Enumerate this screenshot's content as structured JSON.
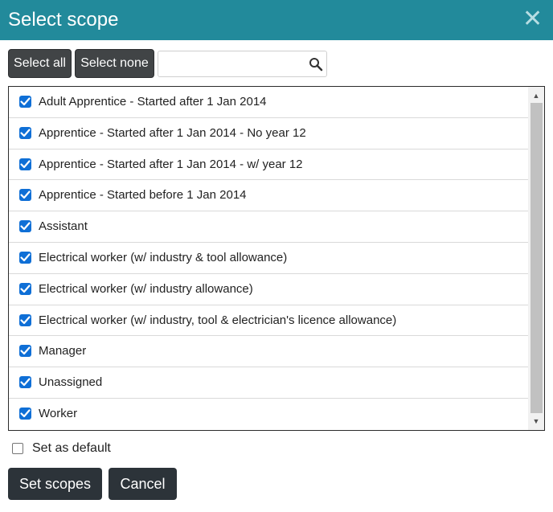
{
  "dialog": {
    "title": "Select scope",
    "close_icon": "close-icon"
  },
  "toolbar": {
    "select_all_label": "Select all",
    "select_none_label": "Select none",
    "search_value": "",
    "search_icon": "search-icon"
  },
  "scopes": [
    {
      "label": "Adult Apprentice - Started after 1 Jan 2014",
      "checked": true
    },
    {
      "label": "Apprentice - Started after 1 Jan 2014 - No year 12",
      "checked": true
    },
    {
      "label": "Apprentice - Started after 1 Jan 2014 - w/ year 12",
      "checked": true
    },
    {
      "label": "Apprentice - Started before 1 Jan 2014",
      "checked": true
    },
    {
      "label": "Assistant",
      "checked": true
    },
    {
      "label": "Electrical worker (w/ industry & tool allowance)",
      "checked": true
    },
    {
      "label": "Electrical worker (w/ industry allowance)",
      "checked": true
    },
    {
      "label": "Electrical worker (w/ industry, tool & electrician's licence allowance)",
      "checked": true
    },
    {
      "label": "Manager",
      "checked": true
    },
    {
      "label": "Unassigned",
      "checked": true
    },
    {
      "label": "Worker",
      "checked": true
    }
  ],
  "default_option": {
    "label": "Set as default",
    "checked": false
  },
  "actions": {
    "set_label": "Set scopes",
    "cancel_label": "Cancel"
  },
  "colors": {
    "header": "#228a9b",
    "checkbox": "#0f6fd6",
    "button": "#2c3339"
  }
}
